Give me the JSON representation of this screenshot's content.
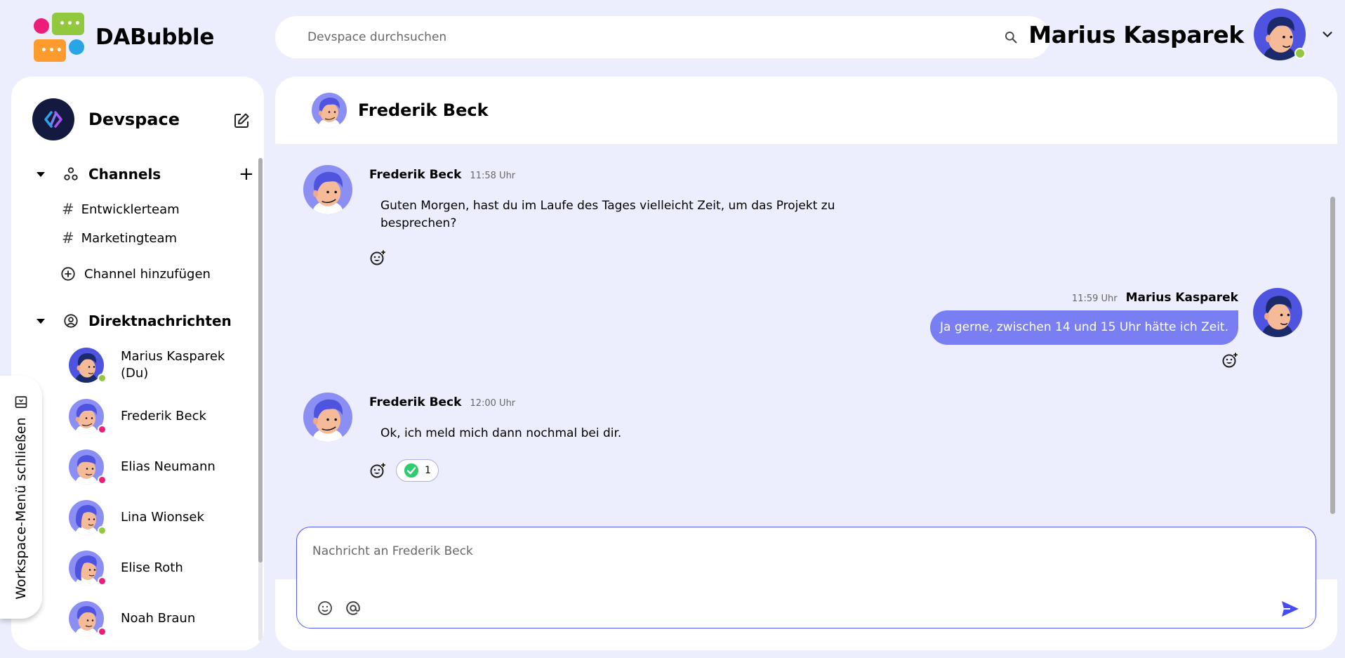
{
  "app": {
    "title": "DABubble",
    "brand_colors": [
      "#92C83E",
      "#FD9C2C",
      "#ED1E79",
      "#29A4E4"
    ]
  },
  "search": {
    "placeholder": "Devspace durchsuchen"
  },
  "header": {
    "user_name": "Marius Kasparek",
    "user_status": "online"
  },
  "sidebar": {
    "workspace_title": "Devspace",
    "channels_label": "Channels",
    "channels": [
      {
        "label": "Entwicklerteam"
      },
      {
        "label": "Marketingteam"
      }
    ],
    "add_channel_label": "Channel hinzufügen",
    "dm_label": "Direktnachrichten",
    "direct_messages": [
      {
        "name_line1": "Marius Kasparek",
        "name_line2": "(Du)",
        "status": "online",
        "status_color": "#92C83E"
      },
      {
        "name": "Frederik Beck",
        "status": "offline",
        "status_color": "#ED1E79"
      },
      {
        "name": "Elias Neumann",
        "status": "offline",
        "status_color": "#ED1E79"
      },
      {
        "name": "Lina Wionsek",
        "status": "online",
        "status_color": "#92C83E"
      },
      {
        "name": "Elise Roth",
        "status": "offline",
        "status_color": "#ED1E79"
      },
      {
        "name": "Noah Braun",
        "status": "offline",
        "status_color": "#ED1E79"
      }
    ]
  },
  "workspace_toggle": {
    "label": "Workspace-Menü schließen"
  },
  "chat": {
    "partner_name": "Frederik Beck",
    "messages": [
      {
        "author": "Frederik Beck",
        "time": "11:58 Uhr",
        "line1": "Guten Morgen, hast du im Laufe des Tages vielleicht Zeit, um das Projekt zu",
        "line2": "besprechen?"
      },
      {
        "author": "Marius Kasparek",
        "time": "11:59 Uhr",
        "text": "Ja gerne, zwischen 14 und 15 Uhr hätte ich Zeit."
      },
      {
        "author": "Frederik Beck",
        "time": "12:00 Uhr",
        "text": "Ok, ich meld mich dann nochmal bei dir.",
        "reaction": {
          "icon": "check-mark",
          "count": "1"
        }
      }
    ],
    "composer_placeholder": "Nachricht an Frederik Beck"
  },
  "colors": {
    "accent": "#797EF3",
    "accent_dark": "#535AF1",
    "background": "#ECEEFE",
    "online": "#92C83E",
    "offline": "#ED1E79"
  }
}
